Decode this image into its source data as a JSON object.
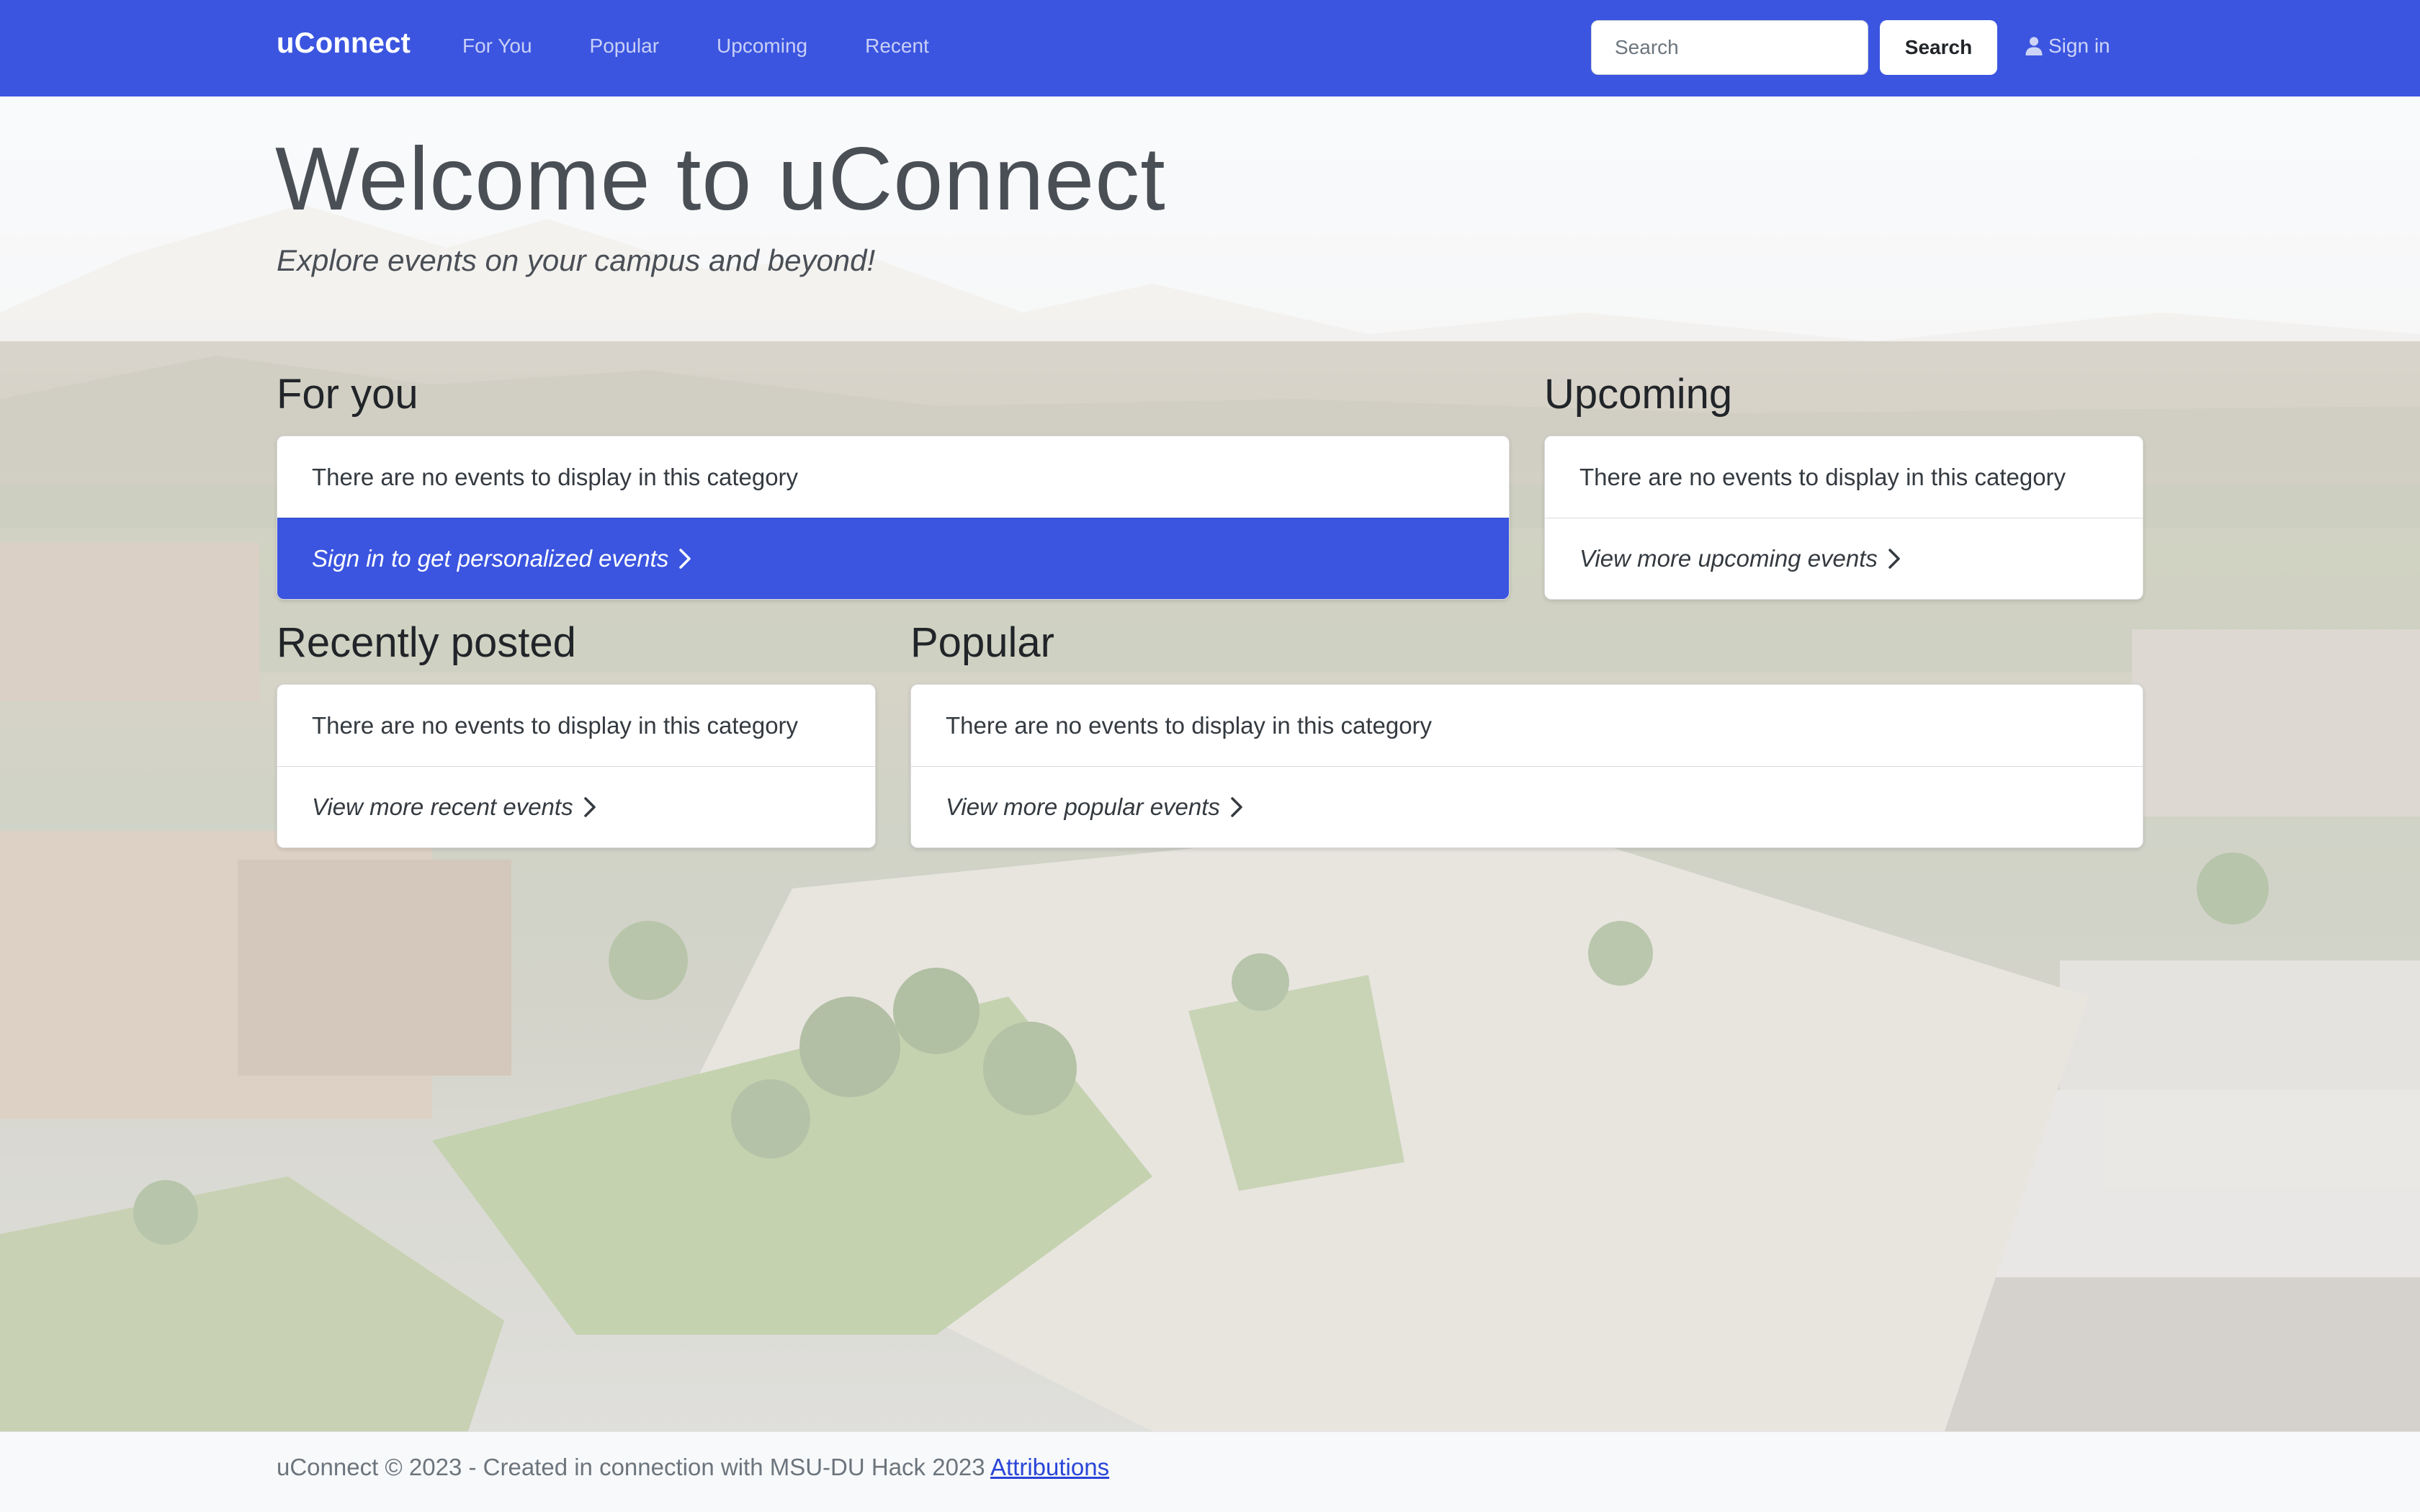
{
  "navbar": {
    "brand": "uConnect",
    "links": [
      "For You",
      "Popular",
      "Upcoming",
      "Recent"
    ],
    "search_placeholder": "Search",
    "search_button": "Search",
    "signin_label": "Sign in",
    "color": "#3b55e0"
  },
  "hero": {
    "title": "Welcome to uConnect",
    "subtitle": "Explore events on your campus and beyond!"
  },
  "sections": {
    "for_you": {
      "title": "For you",
      "empty": "There are no events to display in this category",
      "link": "Sign in to get personalized events"
    },
    "upcoming": {
      "title": "Upcoming",
      "empty": "There are no events to display in this category",
      "link": "View more upcoming events"
    },
    "recent": {
      "title": "Recently posted",
      "empty": "There are no events to display in this category",
      "link": "View more recent events"
    },
    "popular": {
      "title": "Popular",
      "empty": "There are no events to display in this category",
      "link": "View more popular events"
    }
  },
  "footer": {
    "text": "uConnect © 2023 - Created in connection with MSU-DU Hack 2023",
    "link": "Attributions"
  }
}
